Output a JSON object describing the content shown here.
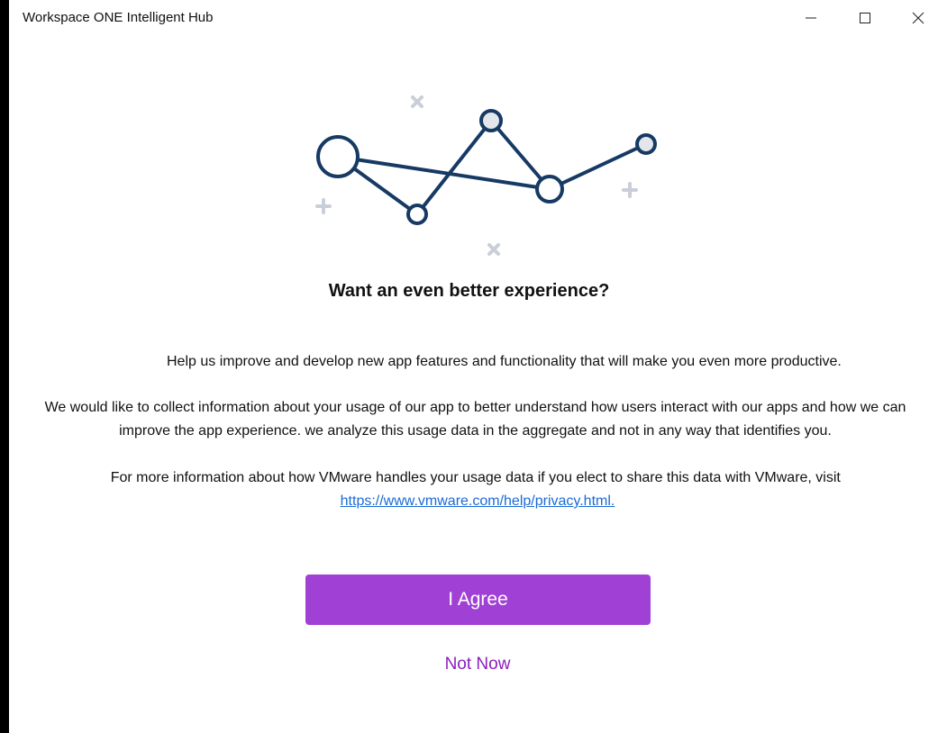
{
  "window": {
    "title": "Workspace ONE Intelligent Hub"
  },
  "icons": {
    "minimize": "minimize-icon",
    "maximize": "maximize-icon",
    "close": "close-icon"
  },
  "content": {
    "heading": "Want an even better experience?",
    "paragraph1": "Help us improve and develop new app features and functionality that will make you even more productive.",
    "paragraph2": "We would like to collect information about your usage of our app to better understand how users interact with our apps and how we can improve the app experience. we analyze this usage data in the aggregate and not in any way that identifies you.",
    "paragraph3": "For more information about how VMware handles your usage data if you elect to share this data with VMware, visit",
    "privacy_link": "https://www.vmware.com/help/privacy.html."
  },
  "actions": {
    "agree_label": "I Agree",
    "not_now_label": "Not Now"
  },
  "colors": {
    "accent": "#a040d4",
    "secondary_link": "#8a1ec0",
    "link": "#1a6bd6",
    "illustration_line": "#163a63",
    "illustration_node_fill": "#e3e7ec",
    "sparkle": "#c9cfd8"
  }
}
